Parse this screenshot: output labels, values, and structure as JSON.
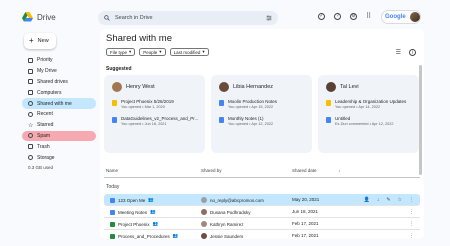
{
  "app": {
    "name": "Drive"
  },
  "search": {
    "placeholder": "Search in Drive"
  },
  "account": {
    "label": "Google"
  },
  "new_button": {
    "label": "New"
  },
  "sidebar": {
    "items": [
      {
        "label": "Priority",
        "icon": "priority-icon"
      },
      {
        "label": "My Drive",
        "icon": "drive-icon"
      },
      {
        "label": "Shared drives",
        "icon": "shared-drives-icon"
      },
      {
        "label": "Computers",
        "icon": "computer-icon"
      },
      {
        "label": "Shared with me",
        "icon": "people-icon"
      },
      {
        "label": "Recent",
        "icon": "clock-icon"
      },
      {
        "label": "Starred",
        "icon": "star-icon"
      },
      {
        "label": "Spam",
        "icon": "spam-icon"
      },
      {
        "label": "Trash",
        "icon": "trash-icon"
      },
      {
        "label": "Storage",
        "icon": "cloud-icon"
      }
    ],
    "storage_text": "0.3 GB used"
  },
  "page": {
    "title": "Shared with me"
  },
  "filters": [
    "File type",
    "People",
    "Last modified"
  ],
  "suggested": {
    "title": "Suggested",
    "cards": [
      {
        "person": "Henry West",
        "files": [
          {
            "name": "Project Phoenix 5/26/2019",
            "sub": "You opened • Mar 1, 2020"
          },
          {
            "name": "DataGuidelines_v2_Process_and_Pr...",
            "sub": "You opened • Jun 18, 2021"
          }
        ]
      },
      {
        "person": "Libia Hernandez",
        "files": [
          {
            "name": "Moolin Production Notes",
            "sub": "You opened • Apr 15, 2022"
          },
          {
            "name": "Monthly Notes (1)",
            "sub": "You opened • Apr 12, 2022"
          }
        ]
      },
      {
        "person": "Tal Levi",
        "files": [
          {
            "name": "Leadership & Organization Updates",
            "sub": "You opened • Apr 14, 2022"
          },
          {
            "name": "Untitled",
            "sub": "Ex-Duri commented • Apr 12, 2022"
          }
        ]
      }
    ]
  },
  "table": {
    "headers": {
      "name": "Name",
      "shared_by": "Shared by",
      "date": "Shared date"
    },
    "group": "Today",
    "rows": [
      {
        "name": "123 Open Me",
        "shared_by": "no_reply@abcpromos.com",
        "date": "May 20, 2021"
      },
      {
        "name": "Meeting Notes",
        "shared_by": "Dusana Podhradsky",
        "date": "Jun 18, 2021"
      },
      {
        "name": "Project Phoenix",
        "shared_by": "Kathryn Ramirez",
        "date": "Feb 17, 2021"
      },
      {
        "name": "Process_and_Procedures",
        "shared_by": "Jessie Saunders",
        "date": "Feb 17, 2021"
      }
    ]
  },
  "colors": {
    "accent": "#c2e7ff",
    "spam_highlight": "#f7a9b2",
    "doc_blue": "#4285f4",
    "sheet_green": "#1e8e3e",
    "slide_yellow": "#fbbc04"
  }
}
